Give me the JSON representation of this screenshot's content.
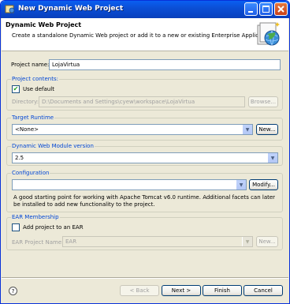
{
  "window": {
    "title": "New Dynamic Web Project"
  },
  "header": {
    "title": "Dynamic Web Project",
    "description": "Create a standalone Dynamic Web project or add it to a new or existing Enterprise Application."
  },
  "project_name": {
    "label": "Project name:",
    "value": "LojaVirtua"
  },
  "project_contents": {
    "title": "Project contents:",
    "use_default_label": "Use default",
    "use_default_checked": true,
    "directory_label": "Directory:",
    "directory_value": "D:\\Documents and Settings\\cyew\\workspace\\LojaVirtua",
    "browse_label": "Browse..."
  },
  "target_runtime": {
    "title": "Target Runtime",
    "value": "<None>",
    "new_label": "New..."
  },
  "module_version": {
    "title": "Dynamic Web Module version",
    "value": "2.5"
  },
  "configuration": {
    "title": "Configuration",
    "value": "",
    "modify_label": "Modify...",
    "info": "A good starting point for working with Apache Tomcat v6.0 runtime. Additional facets can later be installed to add new functionality to the project."
  },
  "ear": {
    "title": "EAR Membership",
    "add_label": "Add project to an EAR",
    "add_checked": false,
    "project_name_label": "EAR Project Name:",
    "project_name_value": "EAR",
    "new_label": "New..."
  },
  "footer": {
    "help_glyph": "?",
    "back_label": "< Back",
    "next_label": "Next >",
    "finish_label": "Finish",
    "cancel_label": "Cancel"
  }
}
